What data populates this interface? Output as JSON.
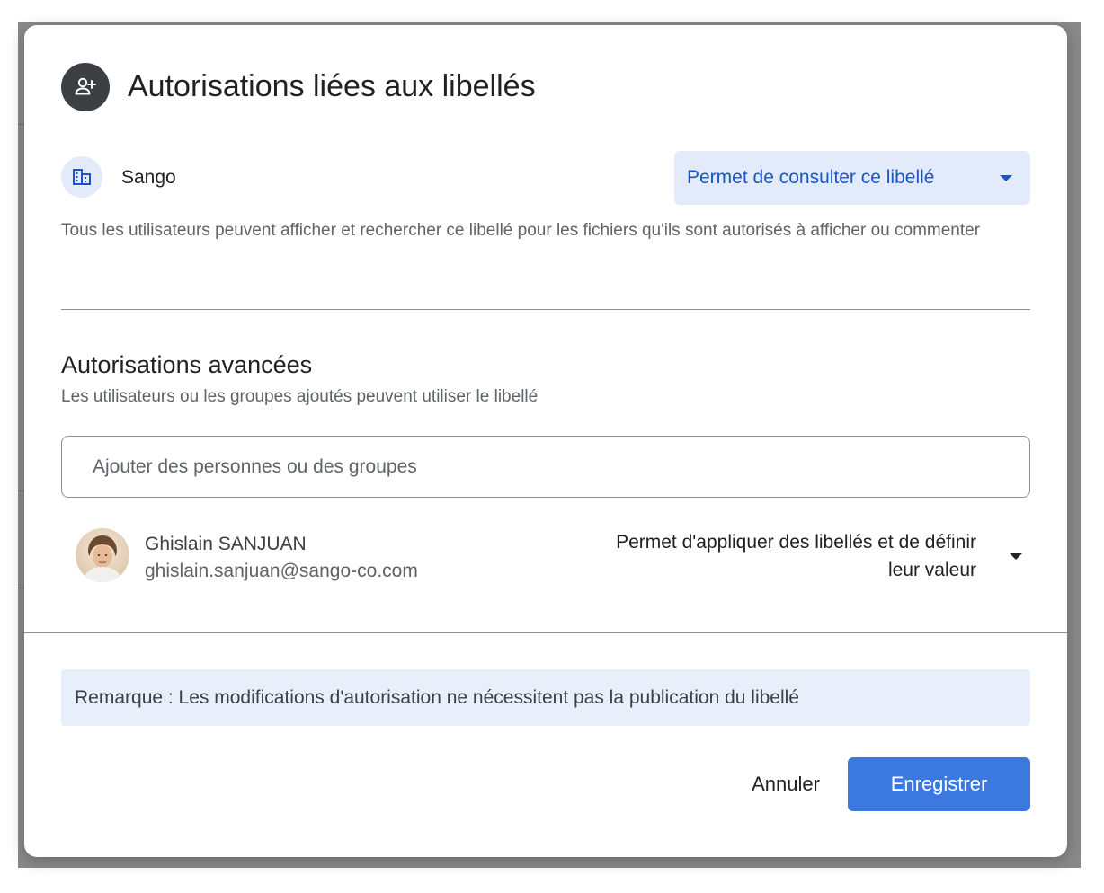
{
  "dialog": {
    "title": "Autorisations liées aux libellés",
    "title_icon": "person-add-icon"
  },
  "organization": {
    "icon": "domain-icon",
    "name": "Sango",
    "permission": "Permet de consulter ce libellé",
    "description": "Tous les utilisateurs peuvent afficher et rechercher ce libellé pour les fichiers qu'ils sont autorisés à afficher ou commenter"
  },
  "advanced": {
    "title": "Autorisations avancées",
    "subtitle": "Les utilisateurs ou les groupes ajoutés peuvent utiliser le libellé",
    "search_placeholder": "Ajouter des personnes ou des groupes",
    "search_value": "",
    "users": [
      {
        "name": "Ghislain SANJUAN",
        "email": "ghislain.sanjuan@sango-co.com",
        "permission": "Permet d'appliquer des libellés et de définir leur valeur"
      }
    ]
  },
  "note": "Remarque : Les modifications d'autorisation ne nécessitent pas la publication du libellé",
  "actions": {
    "cancel": "Annuler",
    "save": "Enregistrer"
  },
  "colors": {
    "accent": "#3b78e0",
    "accent_text": "#1a57c4",
    "chip_background": "#e3ebfb",
    "note_background": "#e8effb",
    "title_icon_background": "#3c4043"
  }
}
